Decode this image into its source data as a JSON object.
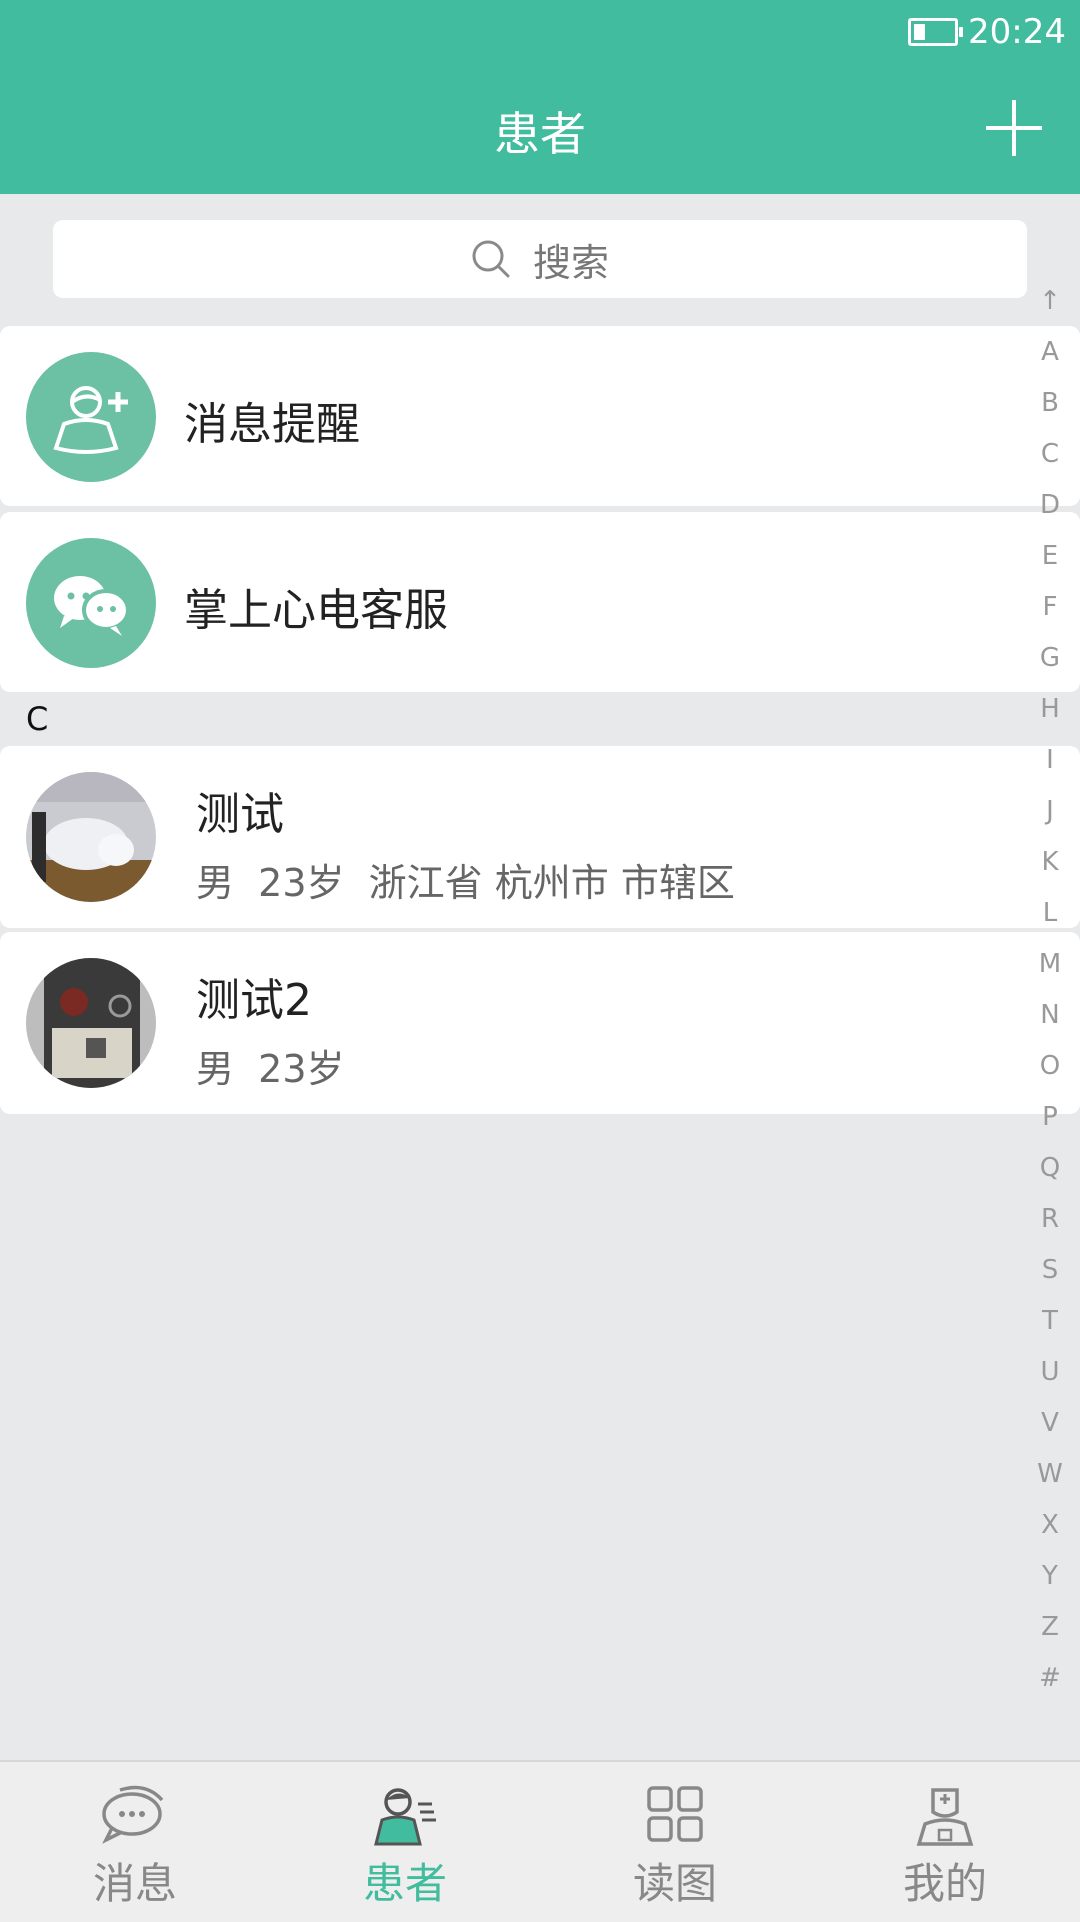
{
  "status": {
    "time": "20:24",
    "battery_level": 0.25
  },
  "header": {
    "title": "患者",
    "add_icon": "plus-icon"
  },
  "search": {
    "placeholder": "搜索",
    "icon": "search-icon"
  },
  "special_items": [
    {
      "label": "消息提醒",
      "icon": "patient-add-icon"
    },
    {
      "label": "掌上心电客服",
      "icon": "wechat-chat-icon"
    }
  ],
  "section_letter": "C",
  "patients": [
    {
      "name": "测试",
      "detail": "男  23岁  浙江省 杭州市 市辖区"
    },
    {
      "name": "测试2",
      "detail": "男  23岁"
    }
  ],
  "index_bar": [
    "↑",
    "A",
    "B",
    "C",
    "D",
    "E",
    "F",
    "G",
    "H",
    "I",
    "J",
    "K",
    "L",
    "M",
    "N",
    "O",
    "P",
    "Q",
    "R",
    "S",
    "T",
    "U",
    "V",
    "W",
    "X",
    "Y",
    "Z",
    "#"
  ],
  "tabs": [
    {
      "label": "消息",
      "icon": "chat-bubble-icon",
      "active": false
    },
    {
      "label": "患者",
      "icon": "patient-icon",
      "active": true
    },
    {
      "label": "读图",
      "icon": "grid-icon",
      "active": false
    },
    {
      "label": "我的",
      "icon": "doctor-icon",
      "active": false
    }
  ],
  "colors": {
    "accent": "#42bc9e",
    "special_icon_bg": "#6cc0a4",
    "background": "#e8e9ea"
  }
}
